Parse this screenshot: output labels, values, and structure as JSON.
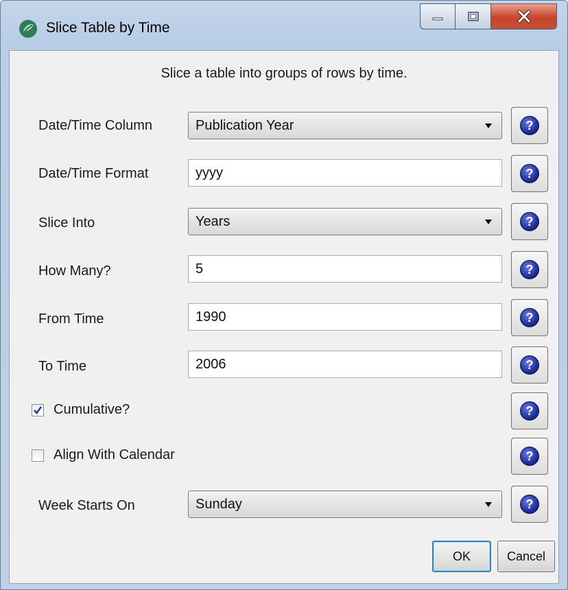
{
  "window": {
    "title": "Slice Table by Time",
    "icon": "sci2-leaf-icon",
    "caption_buttons": {
      "minimize": "minimize-icon",
      "maximize": "maximize-icon",
      "close": "close-icon"
    },
    "close_color": "#c8432b"
  },
  "dialog": {
    "subtitle": "Slice a table into groups of rows by time.",
    "fields": {
      "datetime_column": {
        "label": "Date/Time Column",
        "value": "Publication Year"
      },
      "datetime_format": {
        "label": "Date/Time Format",
        "value": "yyyy"
      },
      "slice_into": {
        "label": "Slice Into",
        "value": "Years"
      },
      "how_many": {
        "label": "How Many?",
        "value": "5"
      },
      "from_time": {
        "label": "From Time",
        "value": "1990"
      },
      "to_time": {
        "label": "To Time",
        "value": "2006"
      },
      "week_starts_on": {
        "label": "Week Starts On",
        "value": "Sunday"
      }
    },
    "cumulative": {
      "label": "Cumulative?",
      "checked": true
    },
    "align_calendar": {
      "label": "Align With Calendar",
      "checked": false
    },
    "help_icon": "help-question-icon",
    "buttons": {
      "ok": "OK",
      "cancel": "Cancel"
    }
  }
}
